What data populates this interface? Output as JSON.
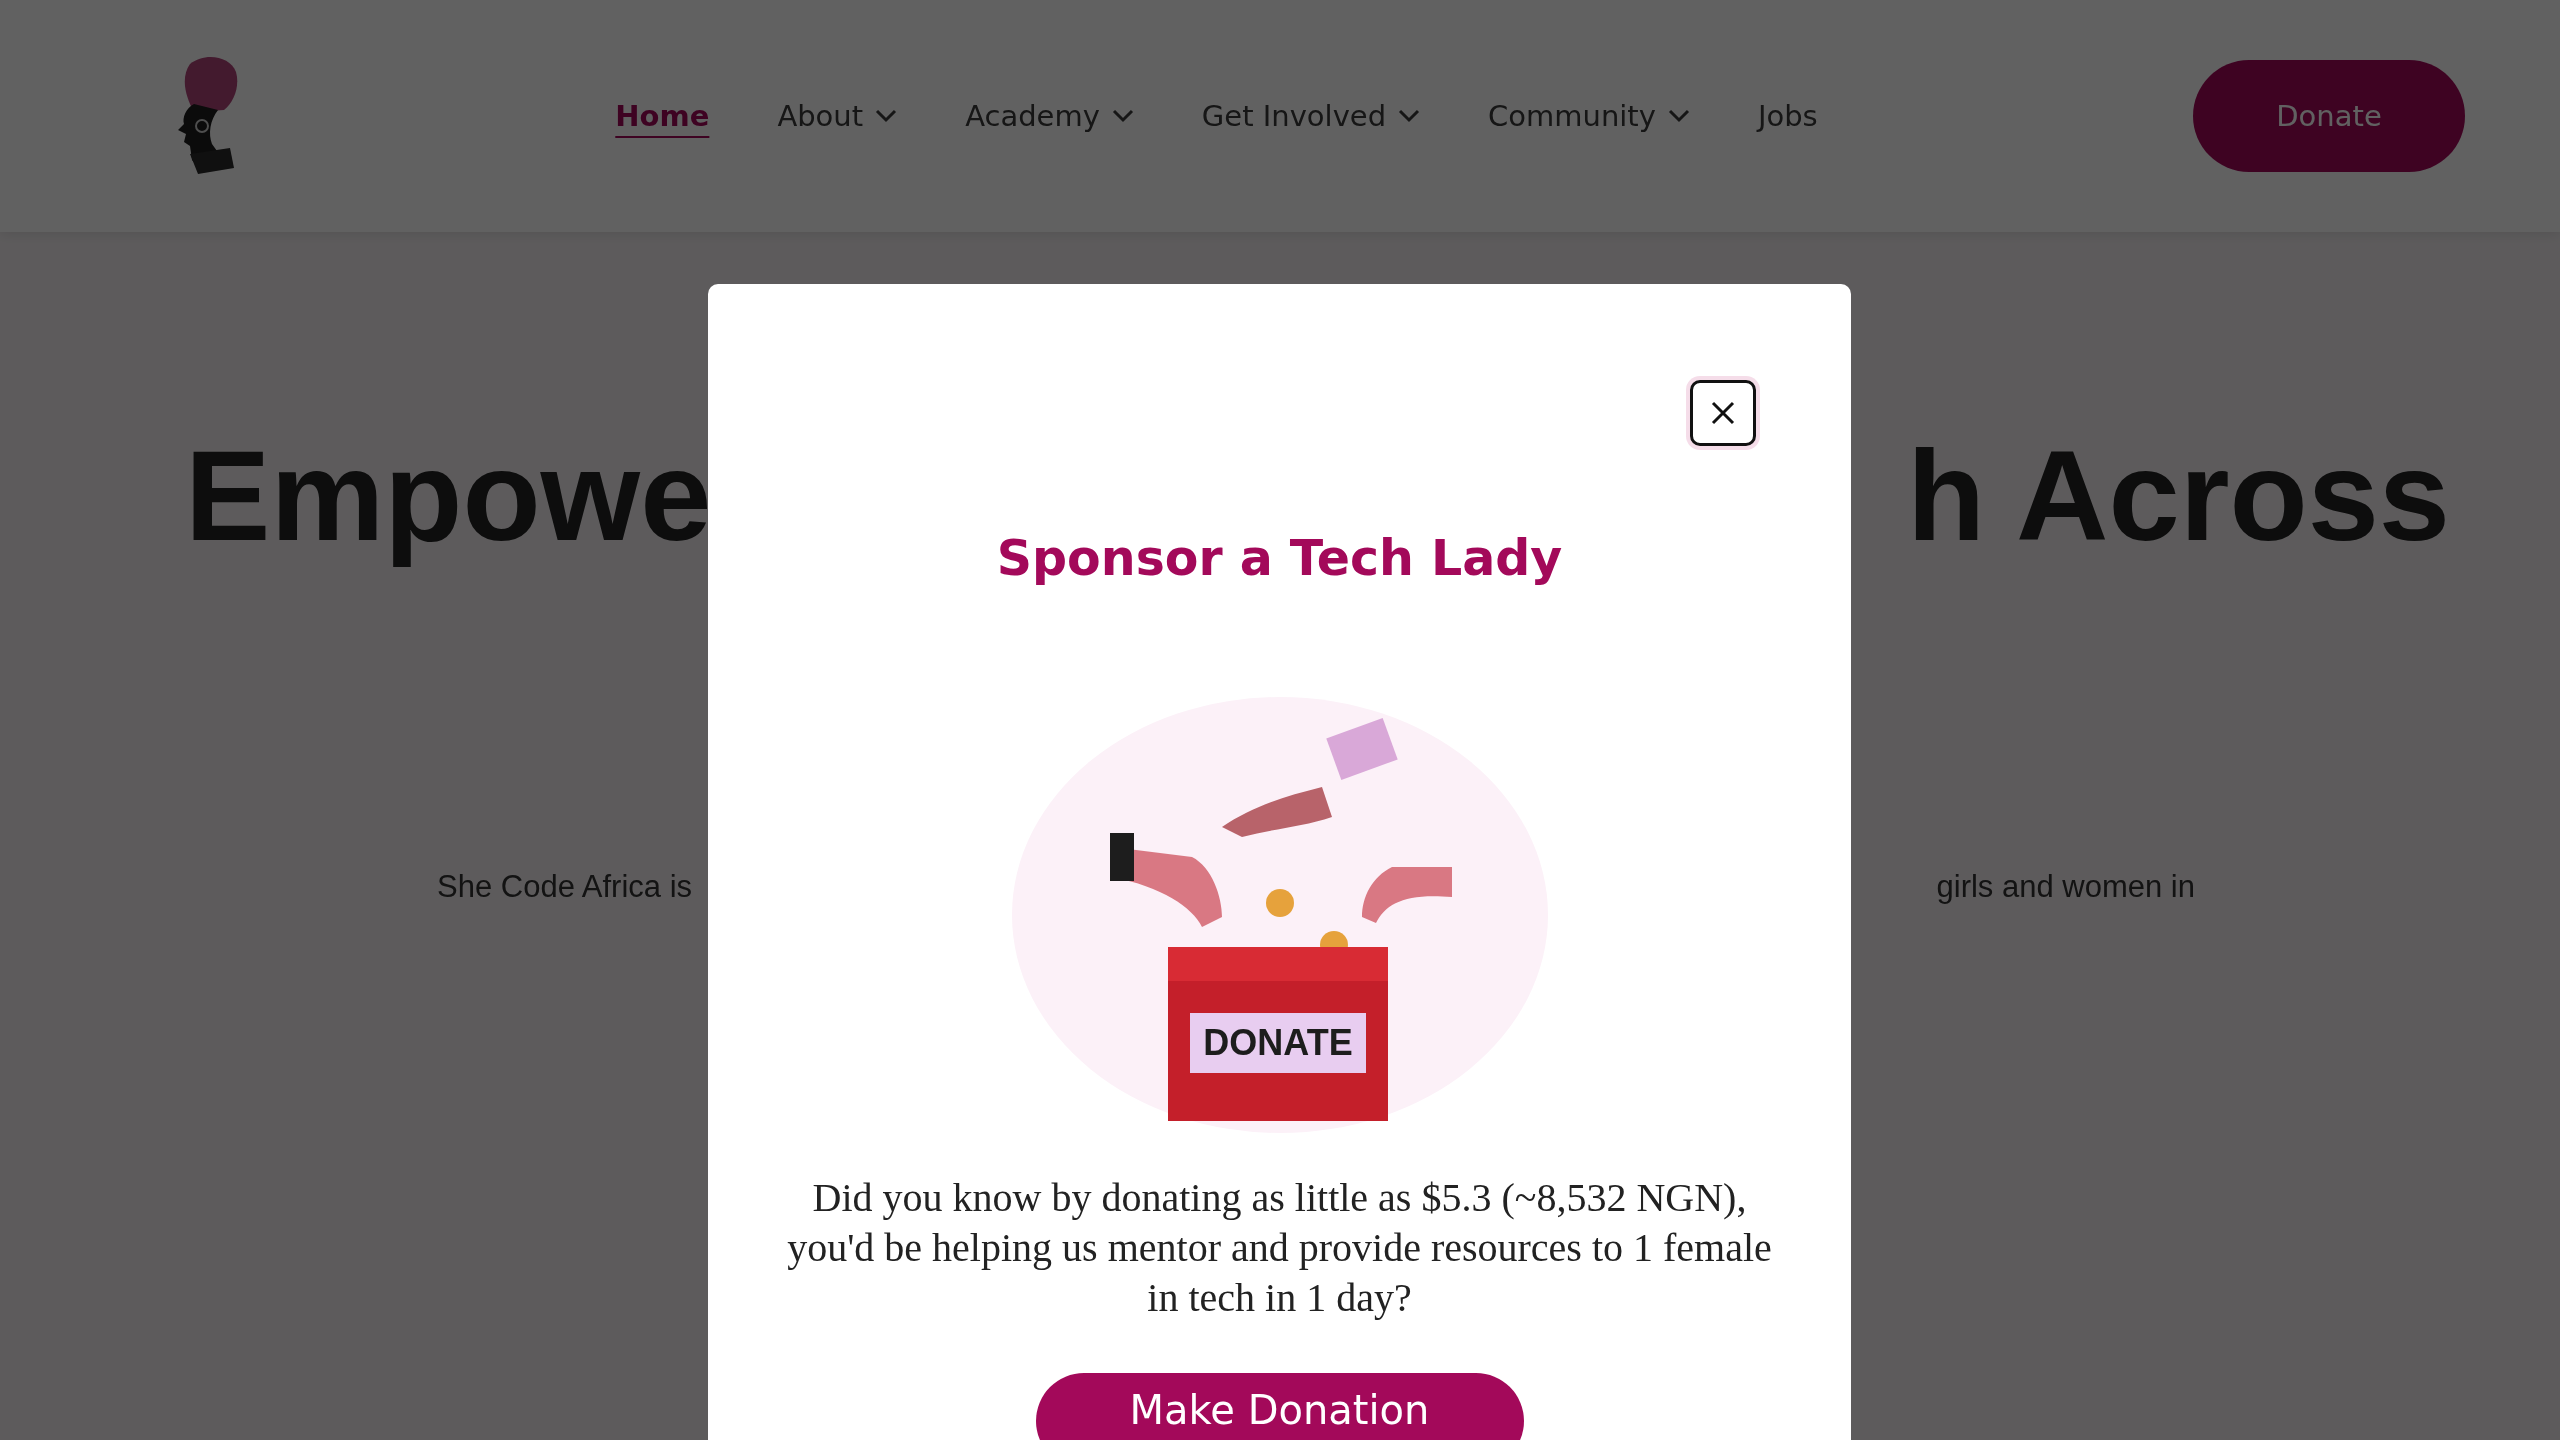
{
  "header": {
    "nav": [
      {
        "label": "Home",
        "selected": true,
        "dropdown": false
      },
      {
        "label": "About",
        "selected": false,
        "dropdown": true
      },
      {
        "label": "Academy",
        "selected": false,
        "dropdown": true
      },
      {
        "label": "Get Involved",
        "selected": false,
        "dropdown": true
      },
      {
        "label": "Community",
        "selected": false,
        "dropdown": true
      },
      {
        "label": "Jobs",
        "selected": false,
        "dropdown": false
      }
    ],
    "donate_button": "Donate"
  },
  "hero": {
    "headline_left": "Empowe",
    "headline_right": "h Across",
    "text_left": "She Code Africa is",
    "text_right": "girls and women in"
  },
  "modal": {
    "title": "Sponsor a Tech Lady",
    "illustration_label": "DONATE",
    "message": "Did you know by donating as little as $5.3 (~8,532 NGN), you'd be helping us mentor and provide resources to 1 female in tech in 1 day?",
    "button": "Make Donation"
  }
}
